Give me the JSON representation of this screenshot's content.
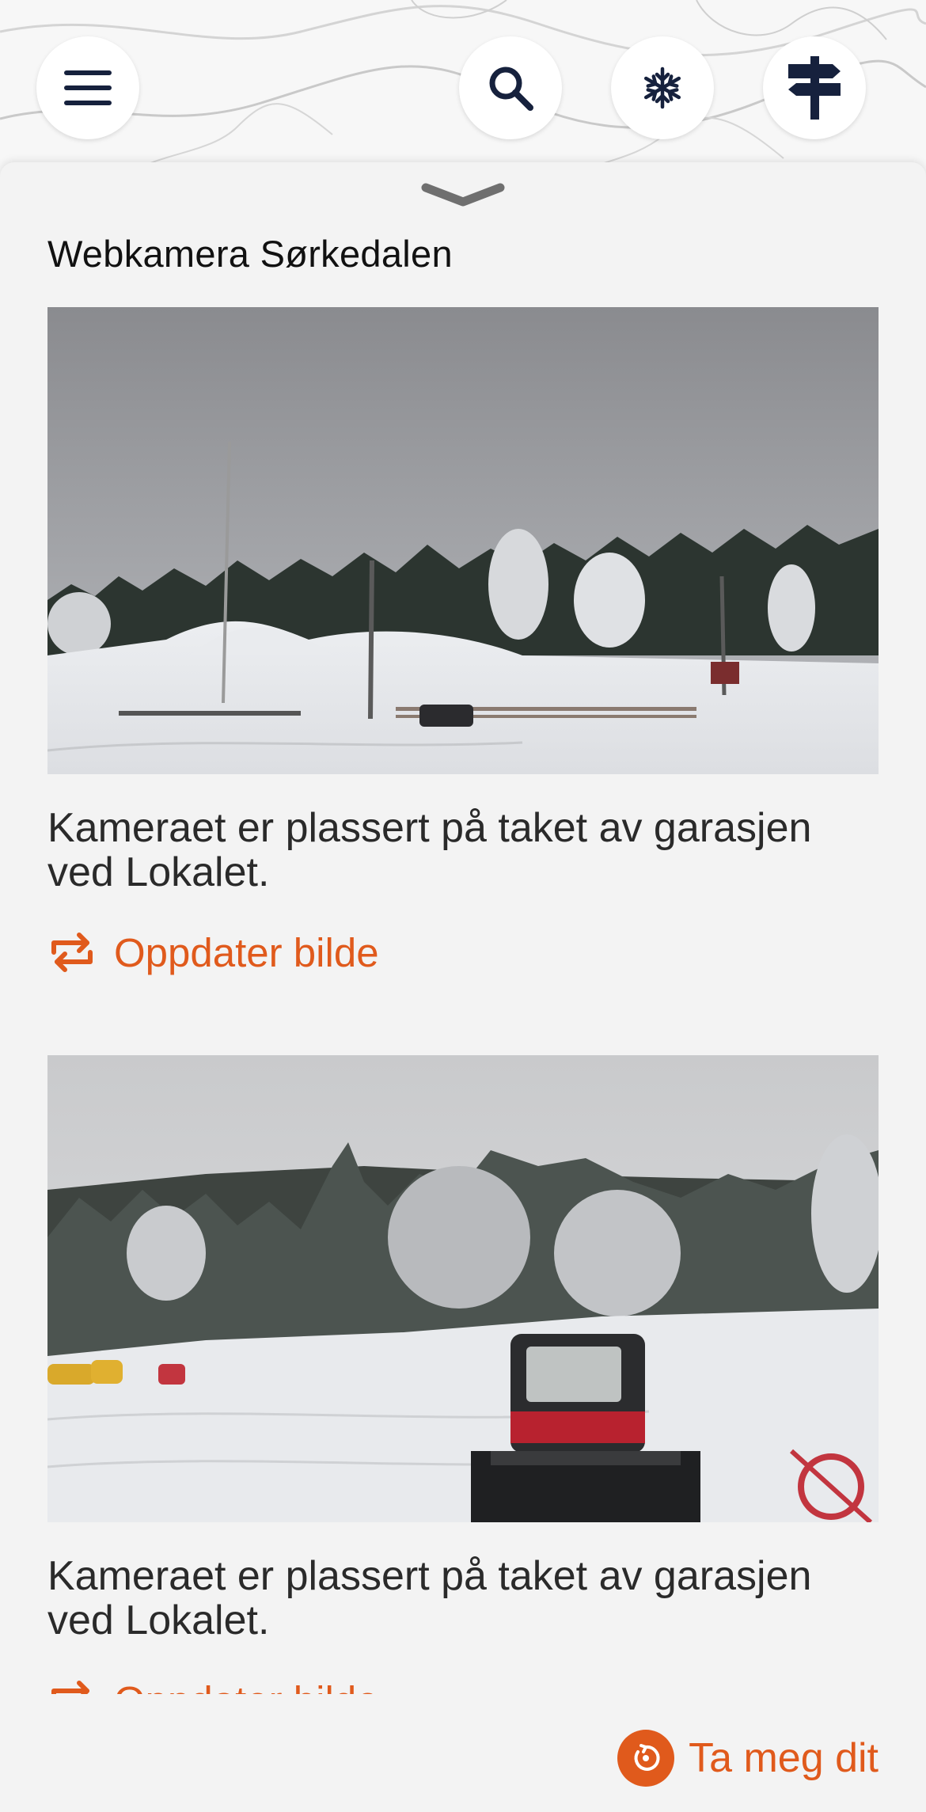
{
  "header": {
    "menu_icon": "hamburger-menu-icon",
    "search_icon": "search-icon",
    "snow_icon": "snowflake-icon",
    "signpost_icon": "signpost-icon"
  },
  "sheet": {
    "title": "Webkamera Sørkedalen",
    "handle_icon": "chevron-down-icon"
  },
  "cameras": [
    {
      "caption": "Kameraet er plassert på taket av garasjen ved Lokalet.",
      "refresh_label": "Oppdater bilde"
    },
    {
      "caption": "Kameraet er plassert på taket av garasjen ved Lokalet.",
      "refresh_label": "Oppdater bilde"
    }
  ],
  "action": {
    "label": "Ta meg dit",
    "icon": "navigate-icon"
  },
  "colors": {
    "accent": "#e05a1c",
    "icon_dark": "#16213d",
    "background": "#f3f3f3"
  }
}
